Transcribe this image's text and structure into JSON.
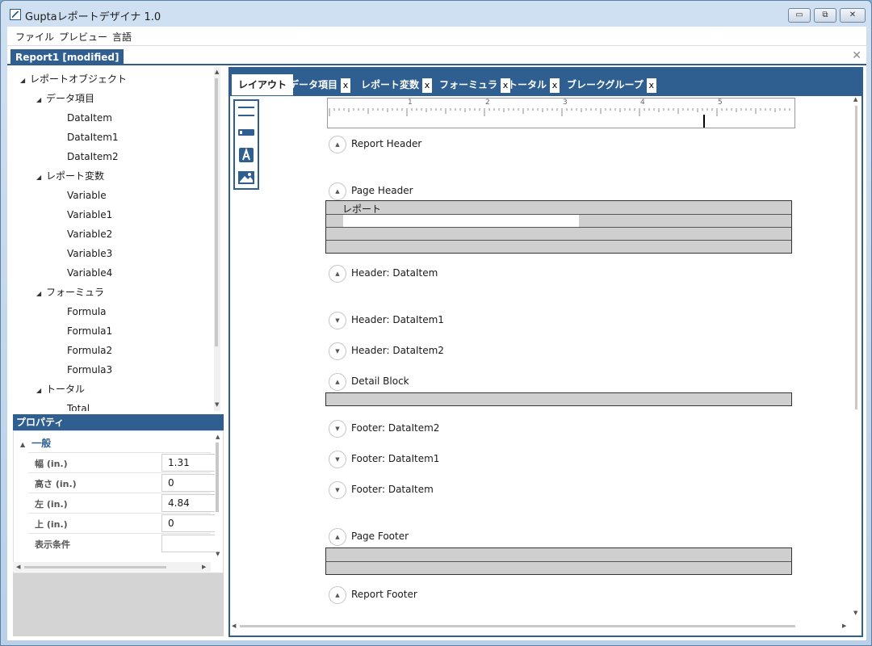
{
  "window": {
    "title": "Guptaレポートデザイナ 1.0",
    "min": "▭",
    "max": "⧉",
    "close": "✕"
  },
  "menu": {
    "file": "ファイル",
    "preview": "プレビュー",
    "language": "言語"
  },
  "document_tab": {
    "label": "Report1 [modified]",
    "close": "✕"
  },
  "tree": {
    "root": "レポートオブジェクト",
    "groups": [
      {
        "label": "データ項目",
        "items": [
          "DataItem",
          "DataItem1",
          "DataItem2"
        ]
      },
      {
        "label": "レポート変数",
        "items": [
          "Variable",
          "Variable1",
          "Variable2",
          "Variable3",
          "Variable4"
        ]
      },
      {
        "label": "フォーミュラ",
        "items": [
          "Formula",
          "Formula1",
          "Formula2",
          "Formula3"
        ]
      },
      {
        "label": "トータル",
        "items": [
          "Total"
        ]
      }
    ]
  },
  "properties": {
    "header": "プロパティ",
    "group": "一般",
    "rows": [
      {
        "label": "幅 (in.)",
        "value": "1.31"
      },
      {
        "label": "高さ (in.)",
        "value": "0"
      },
      {
        "label": "左 (in.)",
        "value": "4.84"
      },
      {
        "label": "上 (in.)",
        "value": "0"
      },
      {
        "label": "表示条件",
        "value": ""
      }
    ]
  },
  "designer_tabs": [
    {
      "label": "レイアウト",
      "active": true
    },
    {
      "label": "データ項目",
      "close": "x"
    },
    {
      "label": "レポート変数",
      "close": "x"
    },
    {
      "label": "フォーミュラ",
      "close": "x"
    },
    {
      "label": "トータル",
      "close": "x"
    },
    {
      "label": "ブレークグループ",
      "close": "x"
    }
  ],
  "ruler": {
    "marks": [
      "1",
      "2",
      "3",
      "4",
      "5"
    ]
  },
  "bands": {
    "report_header": "Report Header",
    "page_header": "Page Header",
    "page_header_text": "レポート",
    "header_dataitem": "Header: DataItem",
    "header_dataitem1": "Header: DataItem1",
    "header_dataitem2": "Header: DataItem2",
    "detail_block": "Detail Block",
    "footer_dataitem2": "Footer: DataItem2",
    "footer_dataitem1": "Footer: DataItem1",
    "footer_dataitem": "Footer: DataItem",
    "page_footer": "Page Footer",
    "report_footer": "Report Footer"
  },
  "colors": {
    "accent": "#2f5f90",
    "band_fill": "#cfcfcf",
    "selection": "#ffffff"
  }
}
